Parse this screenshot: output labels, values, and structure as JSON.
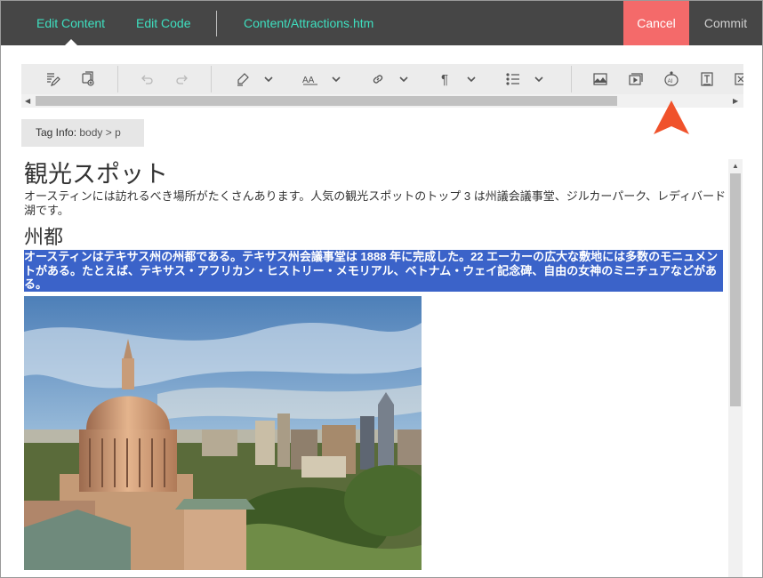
{
  "topbar": {
    "tab_edit_content": "Edit Content",
    "tab_edit_code": "Edit Code",
    "file_path": "Content/Attractions.htm",
    "cancel_label": "Cancel",
    "commit_label": "Commit"
  },
  "toolbar": {
    "icons": [
      "edit-document-icon",
      "insert-snippet-icon",
      "undo-icon",
      "redo-icon",
      "highlight-icon",
      "dropdown-icon",
      "font-size-icon",
      "dropdown-icon",
      "link-icon",
      "dropdown-icon",
      "paragraph-icon",
      "dropdown-icon",
      "list-icon",
      "dropdown-icon",
      "image-icon",
      "video-icon",
      "ai-icon",
      "text-field-icon",
      "more-icon"
    ]
  },
  "tag_info": {
    "label": "Tag Info:",
    "path": "body > p"
  },
  "document": {
    "heading": "観光スポット",
    "intro": "オースティンには訪れるべき場所がたくさんあります。人気の観光スポットのトップ 3 は州議会議事堂、ジルカーパーク、レディバード湖です。",
    "subheading": "州都",
    "selected_paragraph": "オースティンはテキサス州の州都である。テキサス州会議事堂は 1888 年に完成した。22 エーカーの広大な敷地には多数のモニュメントがある。たとえば、テキサス・アフリカン・ヒストリー・メモリアル、ベトナム・ウェイ記念碑、自由の女神のミニチュアなどがある。"
  },
  "colors": {
    "topbar_bg": "#464646",
    "accent": "#3ee0c0",
    "cancel_bg": "#f46a6a",
    "selection": "#3b63c9",
    "pointer": "#f0522b"
  }
}
